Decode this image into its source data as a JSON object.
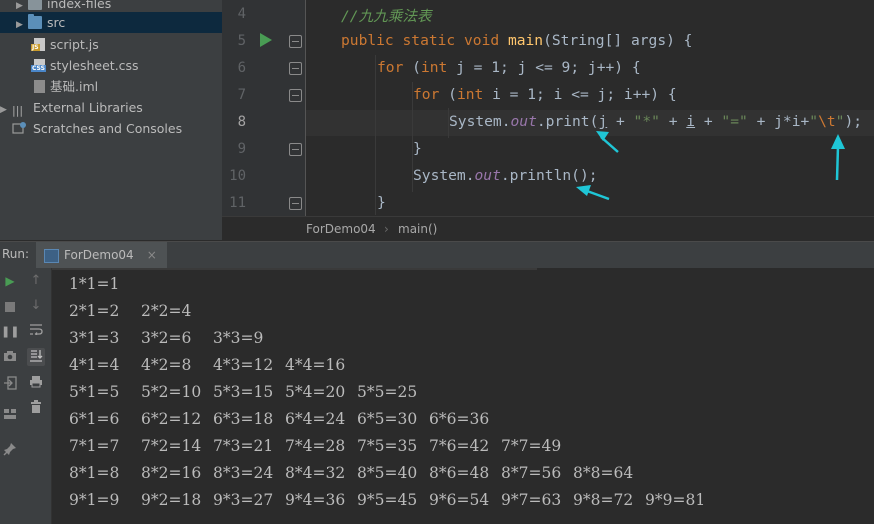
{
  "project_tree": {
    "items": [
      {
        "label": "index-files",
        "icon": "folder-icon",
        "arrow": "▶"
      },
      {
        "label": "src",
        "icon": "folder-icon",
        "arrow": "▶"
      },
      {
        "label": "script.js",
        "icon": "js-file-icon",
        "tag": "JS"
      },
      {
        "label": "stylesheet.css",
        "icon": "css-file-icon",
        "tag": "CSS"
      },
      {
        "label": "基础.iml",
        "icon": "iml-file-icon"
      },
      {
        "label": "External Libraries",
        "icon": "library-icon",
        "arrow": "▶"
      },
      {
        "label": "Scratches and Consoles",
        "icon": "scratches-icon"
      }
    ]
  },
  "editor": {
    "line_numbers": [
      "4",
      "5",
      "6",
      "7",
      "8",
      "9",
      "10",
      "11"
    ],
    "code": {
      "comment": "//九九乘法表",
      "l5_kw": "public static void ",
      "l5_fn": "main",
      "l5_rest": "(String[] args) {",
      "l6_for": "for ",
      "l6_a": "(",
      "l6_int": "int ",
      "l6_b": "j = 1; ",
      "l6_c": "j <= 9; ",
      "l6_d": "j++) {",
      "l7_for": "for ",
      "l7_a": "(",
      "l7_int": "int ",
      "l7_b": "i = 1; ",
      "l7_c": "i <= j; ",
      "l7_d": "i++) {",
      "l8_sys": "System.",
      "l8_out": "out",
      "l8_print": ".print(",
      "l8_j": "j",
      "l8_p1": " + ",
      "l8_s1": "\"*\"",
      "l8_p2": " + ",
      "l8_i": "i",
      "l8_p3": " + ",
      "l8_s2": "\"=\"",
      "l8_p4": " + ",
      "l8_ji": "j*i",
      "l8_p5": "+",
      "l8_q1": "\"",
      "l8_tab": "\\t",
      "l8_q2": "\"",
      "l8_end": ");",
      "l9": "}",
      "l10_sys": "System.",
      "l10_out": "out",
      "l10_rest": ".println();",
      "l11": "}"
    }
  },
  "breadcrumb": {
    "class": "ForDemo04",
    "method": "main()",
    "separator": "›"
  },
  "run_window": {
    "label": "Run:",
    "tab": "ForDemo04",
    "close": "×"
  },
  "console_output": [
    [
      "1*1=1"
    ],
    [
      "2*1=2",
      "2*2=4"
    ],
    [
      "3*1=3",
      "3*2=6",
      "3*3=9"
    ],
    [
      "4*1=4",
      "4*2=8",
      "4*3=12",
      "4*4=16"
    ],
    [
      "5*1=5",
      "5*2=10",
      "5*3=15",
      "5*4=20",
      "5*5=25"
    ],
    [
      "6*1=6",
      "6*2=12",
      "6*3=18",
      "6*4=24",
      "6*5=30",
      "6*6=36"
    ],
    [
      "7*1=7",
      "7*2=14",
      "7*3=21",
      "7*4=28",
      "7*5=35",
      "7*6=42",
      "7*7=49"
    ],
    [
      "8*1=8",
      "8*2=16",
      "8*3=24",
      "8*4=32",
      "8*5=40",
      "8*6=48",
      "8*7=56",
      "8*8=64"
    ],
    [
      "9*1=9",
      "9*2=18",
      "9*3=27",
      "9*4=36",
      "9*5=45",
      "9*6=54",
      "9*7=63",
      "9*8=72",
      "9*9=81"
    ]
  ],
  "colors": {
    "keyword": "#cc7832",
    "comment": "#629755",
    "method": "#ffc66d",
    "string": "#6a8759",
    "field": "#9876aa",
    "annotation_arrow": "#1fc6d6"
  }
}
